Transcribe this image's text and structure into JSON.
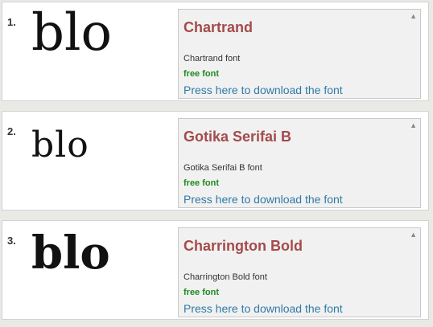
{
  "entries": [
    {
      "number": "1.",
      "sample": "blo",
      "name": "Chartrand",
      "description": "Chartrand font",
      "license": "free font",
      "download": "Press here to download the font"
    },
    {
      "number": "2.",
      "sample": "blo",
      "name": "Gotika Serifai B",
      "description": "Gotika Serifai B font",
      "license": "free font",
      "download": "Press here to download the font"
    },
    {
      "number": "3.",
      "sample": "blo",
      "name": "Charrington Bold",
      "description": "Charrington Bold font",
      "license": "free font",
      "download": "Press here to download the font"
    }
  ],
  "scroll_icon": "up-arrow-icon",
  "colors": {
    "title": "#a54a4a",
    "free": "#1e8a1e",
    "link": "#2f7aa6"
  }
}
